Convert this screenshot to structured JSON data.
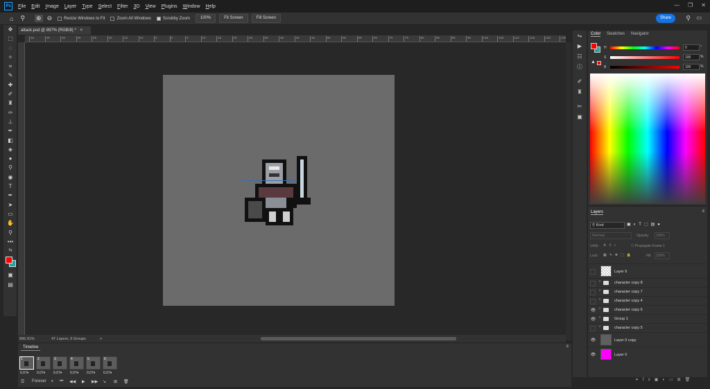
{
  "app": {
    "logo_text": "Ps"
  },
  "menu": [
    "File",
    "Edit",
    "Image",
    "Layer",
    "Type",
    "Select",
    "Filter",
    "3D",
    "View",
    "Plugins",
    "Window",
    "Help"
  ],
  "options": {
    "resize_windows": "Resize Windows to Fit",
    "zoom_all": "Zoom All Windows",
    "scrubby_zoom": "Scrubby Zoom",
    "zoom_pct": "100%",
    "fit_screen": "Fit Screen",
    "fill_screen": "Fill Screen",
    "share": "Share"
  },
  "document": {
    "tab_title": "attack.psd @ 897% (RGB/8) *",
    "close": "×"
  },
  "ruler": {
    "ticks": [
      "45",
      "40",
      "35",
      "30",
      "25",
      "20",
      "15",
      "10",
      "5",
      "0",
      "5",
      "10",
      "15",
      "20",
      "25",
      "30",
      "35",
      "40",
      "45",
      "50",
      "55",
      "60",
      "65",
      "70",
      "75",
      "80",
      "85",
      "90",
      "95",
      "100",
      "105",
      "110",
      "115",
      "120",
      "125"
    ]
  },
  "status": {
    "zoom": "896.91%",
    "info": "47 Layers, 6 Groups",
    "arrow": ">"
  },
  "timeline": {
    "title": "Timeline",
    "frames": [
      {
        "num": "1",
        "dur": "0.07"
      },
      {
        "num": "2",
        "dur": "0.07"
      },
      {
        "num": "3",
        "dur": "0.07"
      },
      {
        "num": "4",
        "dur": "0.07"
      },
      {
        "num": "5",
        "dur": "0.07"
      },
      {
        "num": "6",
        "dur": "0.07"
      }
    ],
    "loop": "Forever"
  },
  "color_panel": {
    "tabs": [
      "Color",
      "Swatches",
      "Navigator"
    ],
    "h_label": "H",
    "s_label": "S",
    "b_label": "B",
    "h_value": "0",
    "s_value": "100",
    "b_value": "100",
    "h_unit": "°",
    "s_unit": "%",
    "b_unit": "%",
    "foreground": "#ff0000",
    "background": "#1fa7a7"
  },
  "layers_panel": {
    "title": "Layers",
    "kind": "Kind",
    "blend": "Normal",
    "opacity_label": "Opacity:",
    "opacity": "100%",
    "unify_label": "Unify:",
    "propagate": "Propagate Frame 1",
    "lock_label": "Lock:",
    "fill_label": "Fill:",
    "fill": "100%",
    "layers": [
      {
        "name": "Layer 9",
        "type": "layer",
        "visible": false,
        "thumb": "checker"
      },
      {
        "name": "character copy 8",
        "type": "group",
        "visible": false
      },
      {
        "name": "character copy 7",
        "type": "group",
        "visible": false
      },
      {
        "name": "character copy 4",
        "type": "group",
        "visible": false
      },
      {
        "name": "character copy 6",
        "type": "group",
        "visible": true
      },
      {
        "name": "Group 1",
        "type": "group",
        "visible": true
      },
      {
        "name": "character copy 5",
        "type": "group",
        "visible": false
      },
      {
        "name": "Layer 0 copy",
        "type": "layer",
        "visible": true,
        "thumb": "#606060"
      },
      {
        "name": "Layer 0",
        "type": "layer",
        "visible": true,
        "thumb": "#ff00ff"
      }
    ]
  }
}
